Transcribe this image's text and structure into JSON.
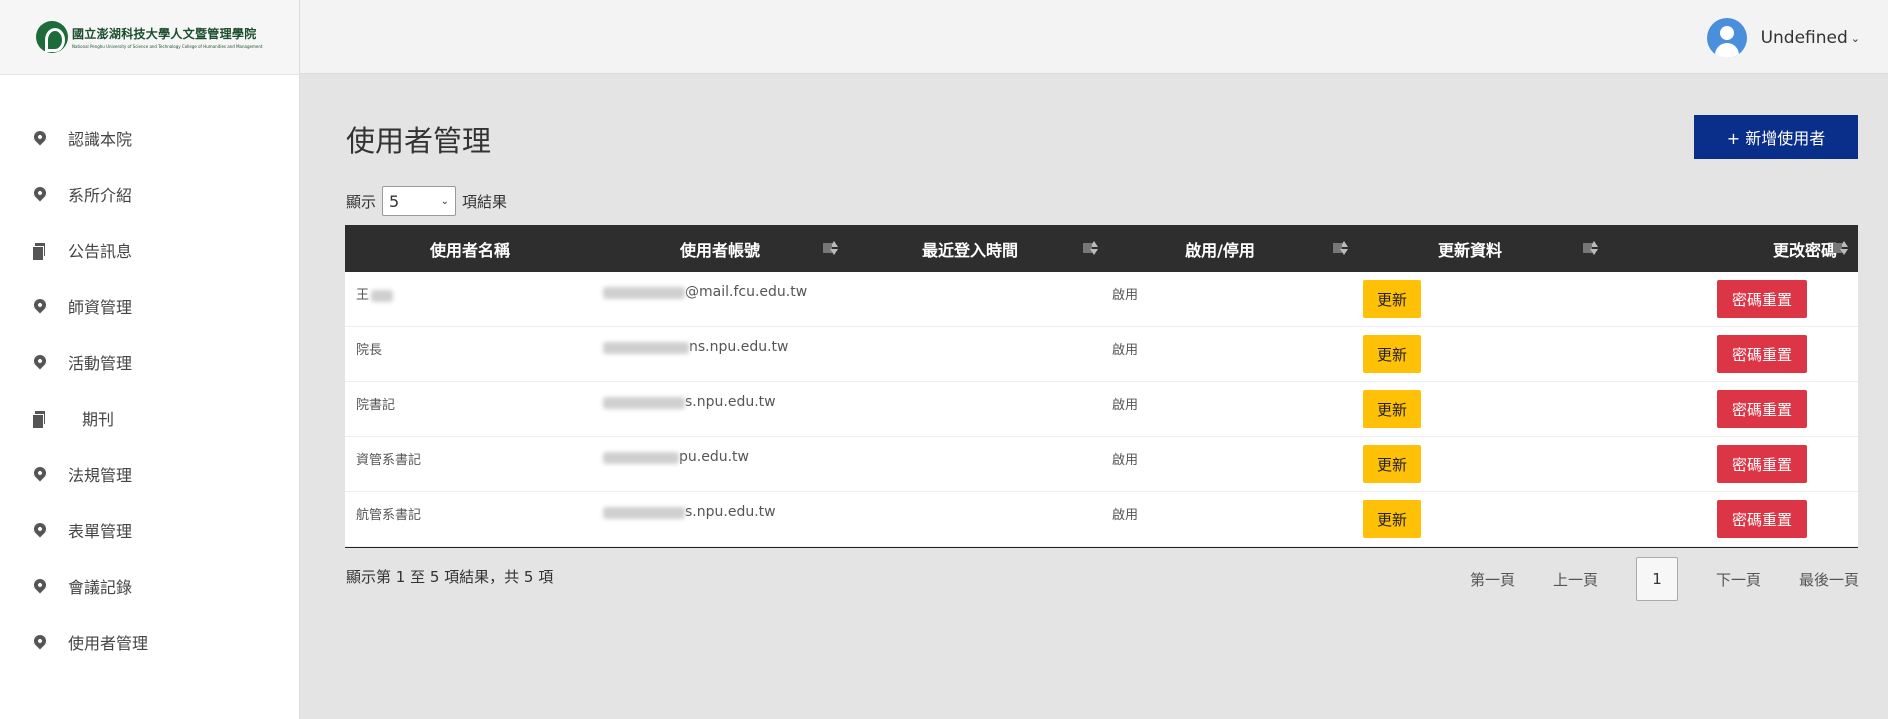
{
  "brand": {
    "title": "國立澎湖科技大學人文暨管理學院",
    "subtitle": "National Penghu University of Science and Technology College of Humanities and Management"
  },
  "user": {
    "name": "Undefined",
    "caret": "⌄"
  },
  "sidebar": {
    "items": [
      {
        "label": "認識本院",
        "icon": "map-pin-icon"
      },
      {
        "label": "系所介紹",
        "icon": "map-pin-icon"
      },
      {
        "label": "公告訊息",
        "icon": "copy-icon"
      },
      {
        "label": "師資管理",
        "icon": "map-pin-icon"
      },
      {
        "label": "活動管理",
        "icon": "map-pin-icon"
      },
      {
        "label": "期刊",
        "icon": "copy-icon"
      },
      {
        "label": "法規管理",
        "icon": "map-pin-icon"
      },
      {
        "label": "表單管理",
        "icon": "map-pin-icon"
      },
      {
        "label": "會議記錄",
        "icon": "map-pin-icon"
      },
      {
        "label": "使用者管理",
        "icon": "map-pin-icon"
      }
    ]
  },
  "main": {
    "title": "使用者管理",
    "add_button": "+ 新增使用者",
    "length": {
      "prefix": "顯示",
      "value": "5",
      "suffix": "項結果"
    },
    "columns": [
      "使用者名稱",
      "使用者帳號",
      "最近登入時間",
      "啟用/停用",
      "更新資料",
      "更改密碼"
    ],
    "rows": [
      {
        "name": "王",
        "account": "@mail.fcu.edu.tw",
        "last_login": "",
        "status": "啟用",
        "update": "更新",
        "reset": "密碼重置"
      },
      {
        "name": "院長",
        "account": "ns.npu.edu.tw",
        "last_login": "",
        "status": "啟用",
        "update": "更新",
        "reset": "密碼重置"
      },
      {
        "name": "院書記",
        "account": "s.npu.edu.tw",
        "last_login": "",
        "status": "啟用",
        "update": "更新",
        "reset": "密碼重置"
      },
      {
        "name": "資管系書記",
        "account": "pu.edu.tw",
        "last_login": "",
        "status": "啟用",
        "update": "更新",
        "reset": "密碼重置"
      },
      {
        "name": "航管系書記",
        "account": "s.npu.edu.tw",
        "last_login": "",
        "status": "啟用",
        "update": "更新",
        "reset": "密碼重置"
      }
    ],
    "info": "顯示第 1 至 5 項結果，共 5 項",
    "pagination": {
      "first": "第一頁",
      "prev": "上一頁",
      "current": "1",
      "next": "下一頁",
      "last": "最後一頁"
    }
  },
  "colors": {
    "primary": "#0a2f8a",
    "update": "#ffc107",
    "reset": "#dc3545",
    "table_header": "#2e2e2e",
    "brand_green": "#1d6b3a"
  }
}
